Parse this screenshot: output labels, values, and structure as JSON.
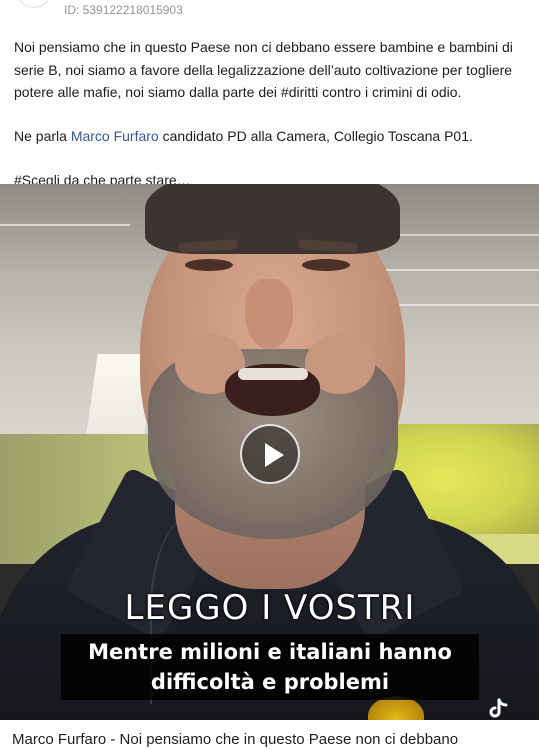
{
  "ad": {
    "id_label": "ID: 539122218015903"
  },
  "body": {
    "paragraph1": "Noi pensiamo che in questo Paese non ci debbano essere bambine e bambini di serie B, noi siamo a favore della legalizzazione dell’auto coltivazione per togliere potere alle mafie, noi siamo dalla parte dei #diritti contro i crimini di odio.",
    "paragraph2_prefix": "Ne parla ",
    "paragraph2_link": "Marco Furfaro",
    "paragraph2_suffix": " candidato PD alla Camera, Collegio Toscana P01.",
    "paragraph3": "#Scegli da che parte stare…"
  },
  "video": {
    "caption_title": "LEGGO I VOSTRI",
    "caption_line1": "Mentre milioni e italiani hanno",
    "caption_line2": "difficoltà e problemi",
    "play_icon": "play-icon",
    "watermark_icon": "tiktok-icon"
  },
  "footer": {
    "title": "Marco Furfaro - Noi pensiamo che in questo Paese non ci debbano"
  }
}
